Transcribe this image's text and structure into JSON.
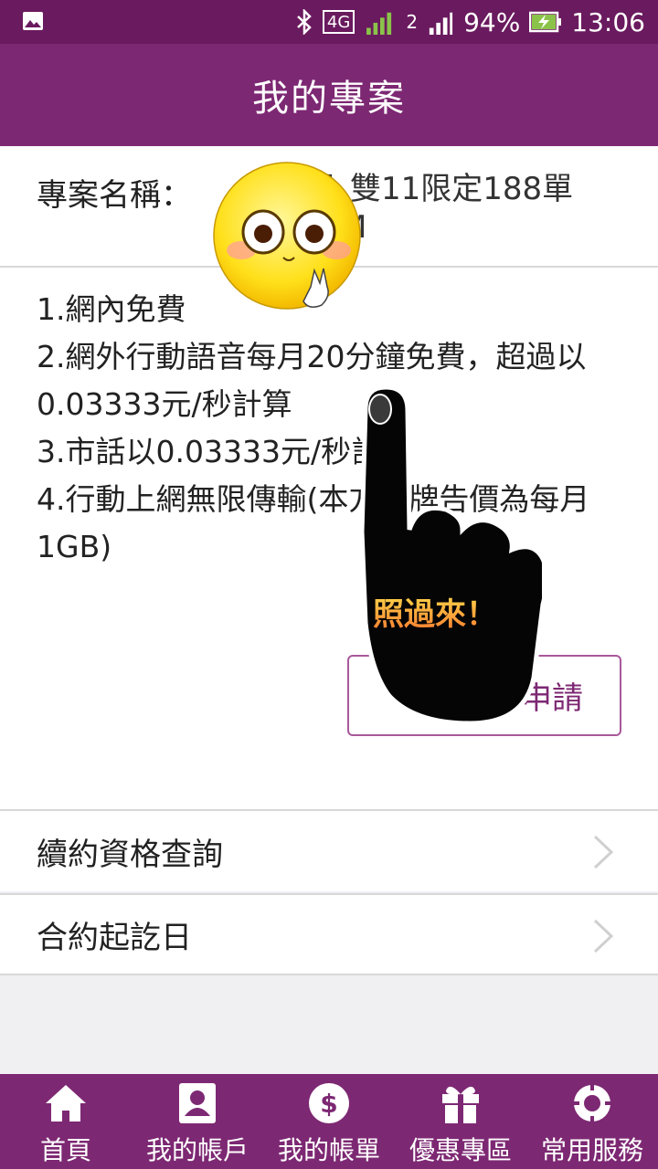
{
  "status_bar": {
    "battery": "94%",
    "time": "13:06",
    "network": "4G",
    "sim2": "2",
    "icons": [
      "image-icon",
      "bluetooth-icon",
      "signal-icon",
      "battery-charging-icon"
    ]
  },
  "header": {
    "title": "我的專案"
  },
  "plan": {
    "name_label": "專案名稱：",
    "name_value_line1": "門_雙11限定188單",
    "name_value_line2": "M"
  },
  "features": [
    "1.網內免費",
    "2.網外行動語音每月20分鐘免費，超過以0.03333元/秒計算",
    "3.市話以0.03333元/秒計算",
    "4.行動上網無限傳輸(本方案牌告價為每月1GB)"
  ],
  "apply_button": {
    "label": "申請"
  },
  "menu": [
    {
      "label": "續約資格查詢"
    },
    {
      "label": "合約起訖日"
    }
  ],
  "sticker": {
    "caption": "照過來！"
  },
  "tabs": [
    {
      "label": "首頁",
      "icon": "home-icon"
    },
    {
      "label": "我的帳戶",
      "icon": "account-icon"
    },
    {
      "label": "我的帳單",
      "icon": "bill-icon"
    },
    {
      "label": "優惠專區",
      "icon": "gift-icon"
    },
    {
      "label": "常用服務",
      "icon": "services-icon"
    }
  ],
  "colors": {
    "primary": "#7d2873",
    "status_bar": "#6a1a5e",
    "background": "#f0eff2"
  }
}
